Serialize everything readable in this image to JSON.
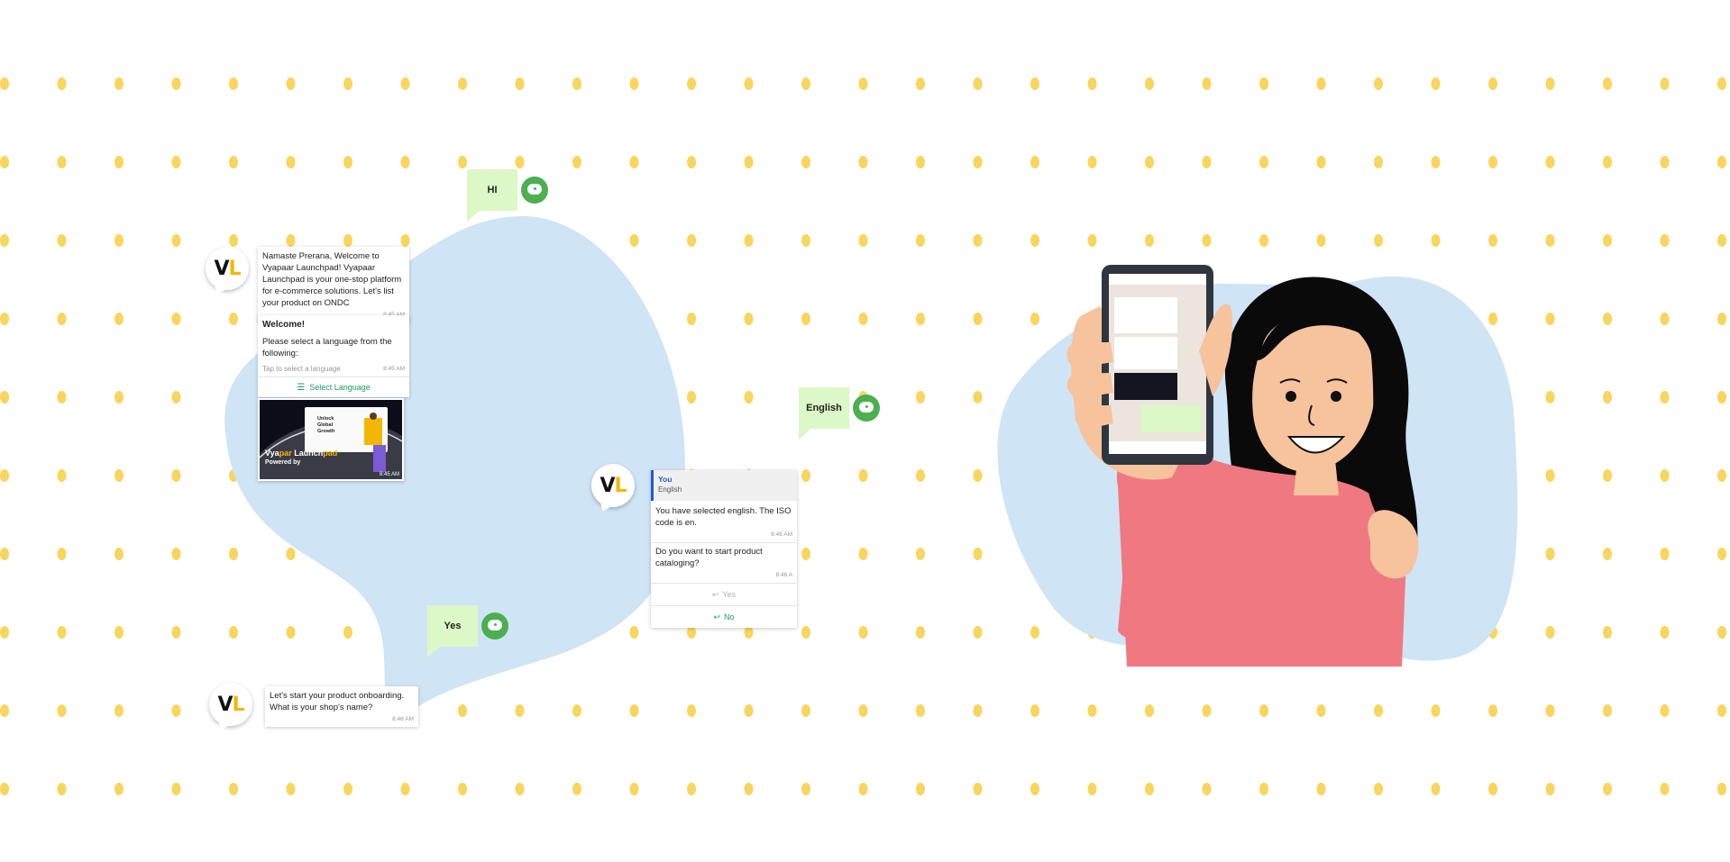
{
  "colors": {
    "dot": "#f8d55d",
    "blob": "#cfe4f5",
    "reply_bubble": "#dcf8c6",
    "accent_green": "#1a9c6a",
    "brand_yellow": "#f2b705"
  },
  "avatar": {
    "letter1": "V",
    "letter2": "L"
  },
  "welcome_card": {
    "message": "Namaste Prerana, Welcome to Vyapaar Launchpad! Vyapaar Launchpad is your one-stop platform for e-commerce solutions. Let's list your product on ONDC",
    "time": "8:45 AM"
  },
  "language_card": {
    "title": "Welcome!",
    "body": "Please select a language from the following:",
    "hint": "Tap to select a language",
    "time": "8:45 AM",
    "button": "Select Language"
  },
  "banner": {
    "brand_part1": "Vya",
    "brand_part2": "par",
    "brand_part3": " Launch",
    "brand_part4": "pad",
    "powered_by": "Powered by",
    "tagline": "Unlock Global Growth",
    "time": "8:45 AM"
  },
  "replies": {
    "hi": "HI",
    "english": "English",
    "yes": "Yes"
  },
  "iso_card": {
    "quote_author": "You",
    "quote_text": "English",
    "message": "You have selected english. The ISO code is en.",
    "time": "8:46 AM",
    "question": "Do you want to start product cataloging?",
    "question_time": "8:46 A",
    "option_yes": "Yes",
    "option_no": "No"
  },
  "onboarding_card": {
    "message": "Let's start your product onboarding. What is your shop's name?",
    "time": "8:46 AM"
  }
}
